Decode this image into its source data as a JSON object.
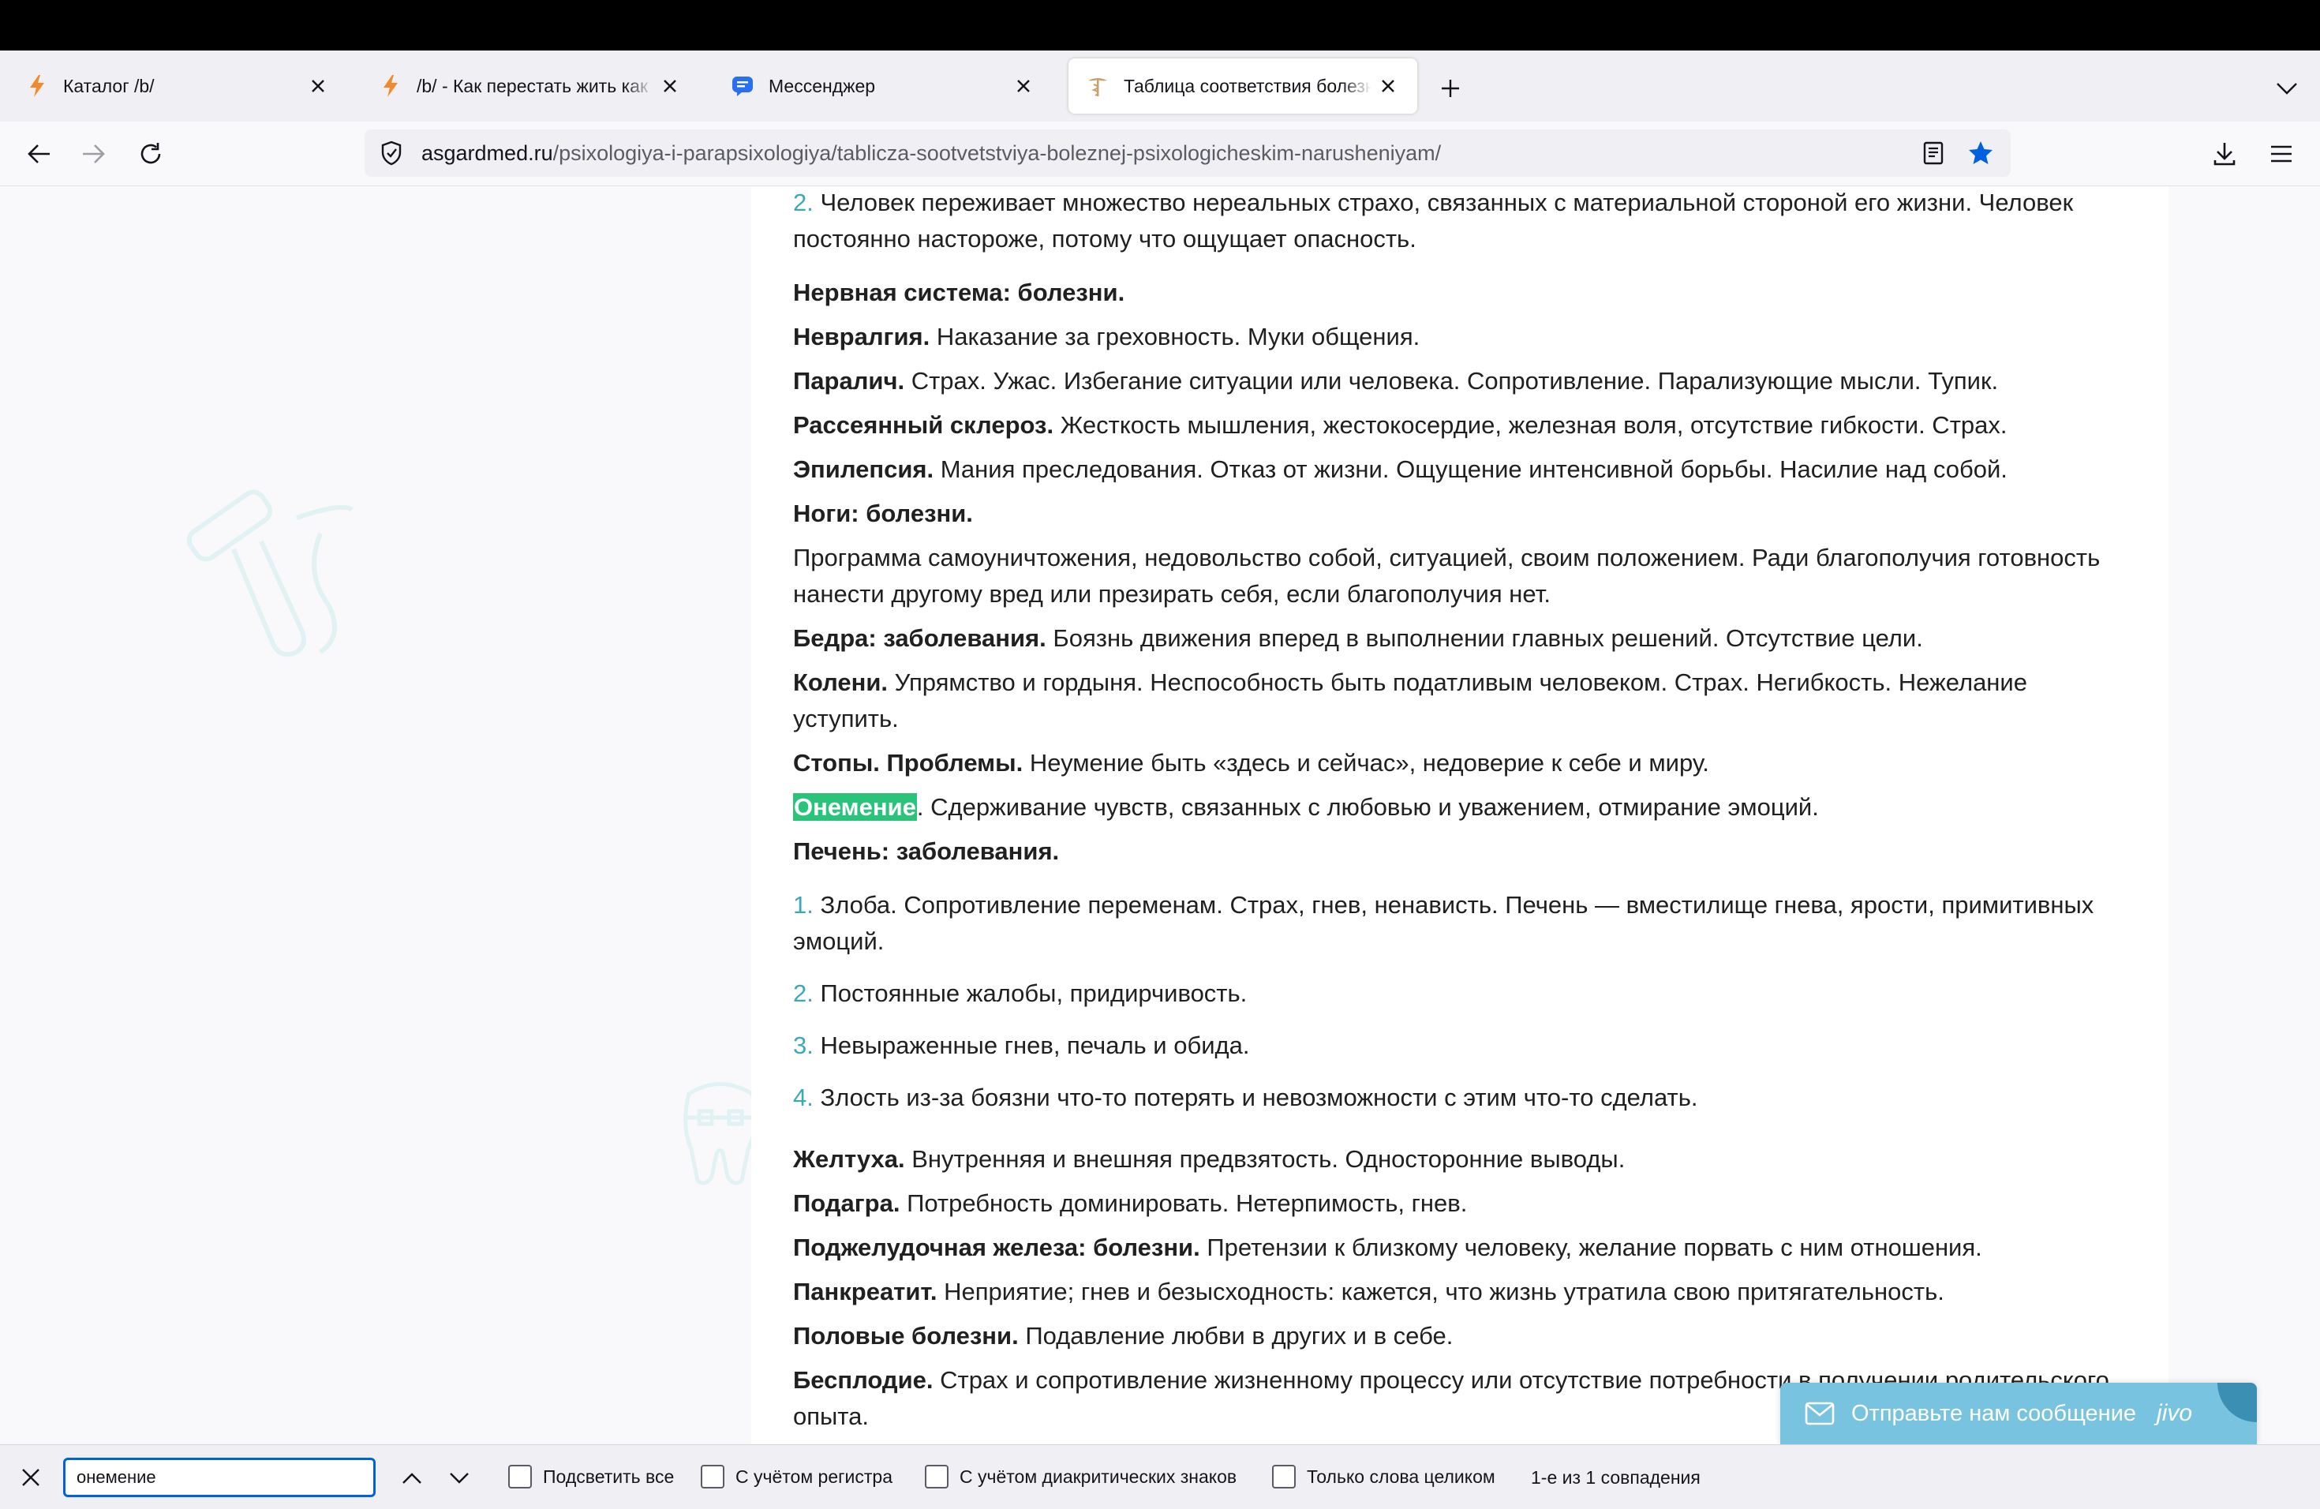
{
  "tabs": [
    {
      "title": "Каталог /b/",
      "icon": "lightning-icon"
    },
    {
      "title": "/b/ - Как перестать жить как хуесос",
      "icon": "lightning-icon"
    },
    {
      "title": "Мессенджер",
      "icon": "chat-bubble-icon"
    },
    {
      "title": "Таблица соответствия болезней психологическим нарушениям",
      "icon": "caduceus-icon",
      "active": true
    }
  ],
  "url": {
    "host": "asgardmed.ru",
    "path": "/psixologiya-i-parapsixologiya/tablicza-sootvetstviya-boleznej-psixologicheskim-narusheniyam/"
  },
  "article": {
    "intro_num": "2.",
    "intro_text": "Человек переживает множество нереальных страхо, связанных с материальной стороной его жизни. Человек постоянно настороже, потому что ощущает опасность.",
    "nervous_heading": "Нервная система: болезни.",
    "entries1": [
      {
        "term": "Невралгия.",
        "text": "Наказание за греховность. Муки общения."
      },
      {
        "term": "Паралич.",
        "text": "Страх. Ужас. Избегание ситуации или человека. Сопротивление. Парализующие мысли. Тупик."
      },
      {
        "term": "Рассеянный склероз.",
        "text": "Жесткость мышления, жестокосердие, железная воля, отсутствие гибкости. Страх."
      },
      {
        "term": "Эпилепсия.",
        "text": "Мания преследования. Отказ от жизни. Ощущение интенсивной борьбы. Насилие над собой."
      }
    ],
    "legs_heading": "Ноги: болезни.",
    "legs_text": "Программа самоуничтожения, недовольство собой, ситуацией, своим положением. Ради благополучия готовность нанести другому вред или презирать себя, если благополучия нет.",
    "entries2": [
      {
        "term": "Бедра: заболевания.",
        "text": "Боязнь движения вперед в выполнении главных решений. Отсутствие цели."
      },
      {
        "term": "Колени.",
        "text": "Упрямство и гордыня. Неспособность быть податливым человеком. Страх. Негибкость. Нежелание уступить."
      },
      {
        "term": "Стопы. Проблемы.",
        "text": "Неумение быть «здесь и сейчас», недоверие к себе и миру."
      }
    ],
    "numbness_term": "Онемение",
    "numbness_text": ". Сдерживание чувств, связанных с любовью и уважением, отмирание эмоций.",
    "liver_heading": "Печень: заболевания.",
    "liver_list": [
      {
        "num": "1.",
        "text": "Злоба. Сопротивление переменам. Страх, гнев, ненависть. Печень — вместилище гнева, ярости, примитивных эмоций."
      },
      {
        "num": "2.",
        "text": "Постоянные жалобы, придирчивость."
      },
      {
        "num": "3.",
        "text": "Невыраженные гнев, печаль и обида."
      },
      {
        "num": "4.",
        "text": "Злость из-за боязни что-то потерять и невозможности с этим что-то сделать."
      }
    ],
    "entries3": [
      {
        "term": "Желтуха.",
        "text": "Внутренняя и внешняя предвзятость. Односторонние выводы."
      },
      {
        "term": "Подагра.",
        "text": "Потребность доминировать. Нетерпимость, гнев."
      },
      {
        "term": "Поджелудочная железа: болезни.",
        "text": "Претензии к близкому человеку, желание порвать с ним отношения."
      },
      {
        "term": "Панкреатит.",
        "text": "Неприятие; гнев и безысходность: кажется, что жизнь утратила свою притягательность."
      },
      {
        "term": "Половые болезни.",
        "text": "Подавление любви в других и в себе."
      },
      {
        "term": "Бесплодие.",
        "text": "Страх и сопротивление жизненному процессу или отсутствие потребности в получении родительского опыта."
      }
    ]
  },
  "chat_widget": {
    "label": "Отправьте нам сообщение",
    "brand": "jivo"
  },
  "findbar": {
    "query": "онемение",
    "highlight_all": "Подсветить все",
    "match_case": "С учётом регистра",
    "match_diacritics": "С учётом диакритических знаков",
    "whole_words": "Только слова целиком",
    "status": "1-е из 1 совпадения"
  },
  "colors": {
    "accent": "#3aaab5",
    "match": "#2ac37a",
    "star": "#0061e0",
    "chat": "#78c4e0"
  }
}
